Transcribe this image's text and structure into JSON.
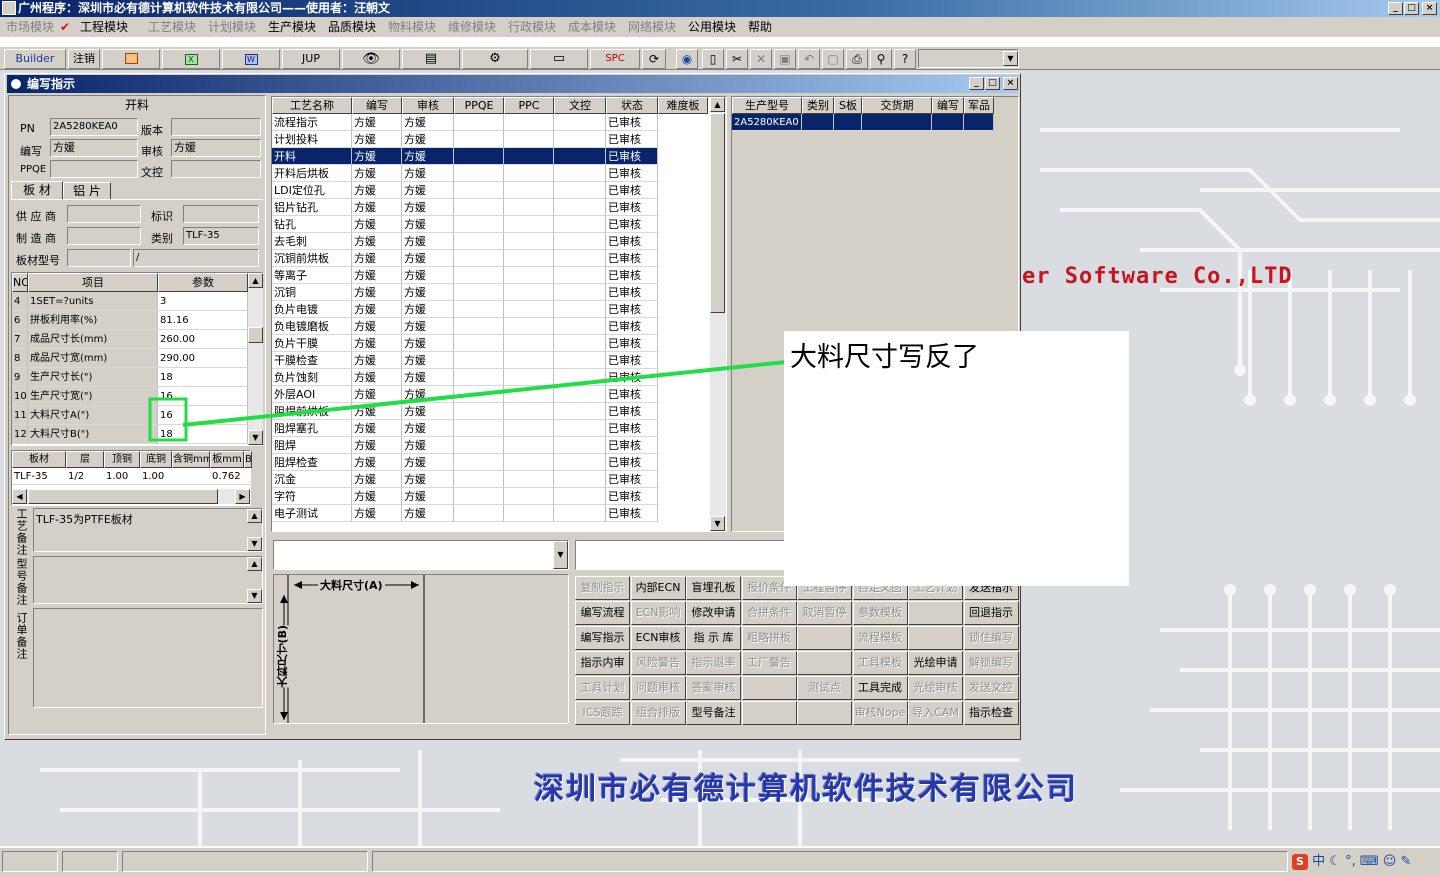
{
  "app": {
    "title": "广州程序：深圳市必有德计算机软件技术有限公司——使用者：汪朝文",
    "min": "_",
    "max": "□",
    "close": "×"
  },
  "menu": [
    {
      "label": "市场模块",
      "enabled": false
    },
    {
      "label": "工程模块",
      "enabled": true,
      "checked": true
    },
    {
      "label": "工艺模块",
      "enabled": false
    },
    {
      "label": "计划模块",
      "enabled": false
    },
    {
      "label": "生产模块",
      "enabled": true
    },
    {
      "label": "品质模块",
      "enabled": true
    },
    {
      "label": "物料模块",
      "enabled": false
    },
    {
      "label": "维修模块",
      "enabled": false
    },
    {
      "label": "行政模块",
      "enabled": false
    },
    {
      "label": "成本模块",
      "enabled": false
    },
    {
      "label": "网络模块",
      "enabled": false
    },
    {
      "label": "公用模块",
      "enabled": true
    },
    {
      "label": "帮助",
      "enabled": true
    }
  ],
  "toolbar": {
    "builder": "Builder",
    "logout": "注销",
    "jup": "JUP",
    "spc": "SPC"
  },
  "background": {
    "watermark": "er Software Co.,LTD",
    "company": "深圳市必有德计算机软件技术有限公司"
  },
  "window": {
    "title": "编写指示",
    "left": {
      "section_title": "开料",
      "pn_label": "PN",
      "pn": "2A5280KEA0",
      "version_label": "版本",
      "version": "",
      "writer_label": "编写",
      "writer": "方媛",
      "reviewer_label": "审核",
      "reviewer": "方媛",
      "ppqe_label": "PPQE",
      "ppqe": "",
      "wenkong_label": "文控",
      "wenkong": "",
      "tabs": [
        "板 材",
        "铝 片"
      ],
      "supplier_label": "供 应 商",
      "supplier": "",
      "mark_label": "标识",
      "mark": "",
      "maker_label": "制 造 商",
      "maker": "",
      "category_label": "类别",
      "category": "TLF-35",
      "model_label": "板材型号",
      "model": "",
      "model2": "/",
      "param_headers": [
        "NO",
        "项目",
        "参数"
      ],
      "params": [
        [
          "4",
          "1SET=?units",
          "3"
        ],
        [
          "6",
          "拼板利用率(%)",
          "81.16"
        ],
        [
          "7",
          "成品尺寸长(mm)",
          "260.00"
        ],
        [
          "8",
          "成品尺寸宽(mm)",
          "290.00"
        ],
        [
          "9",
          "生产尺寸长(\")",
          "18"
        ],
        [
          "10",
          "生产尺寸宽(\")",
          "16"
        ],
        [
          "11",
          "大料尺寸A(\")",
          "16"
        ],
        [
          "12",
          "大料尺寸B(\")",
          "18"
        ]
      ],
      "board_headers": [
        "板材",
        "层",
        "顶铜",
        "底铜",
        "含铜mm",
        "板mm",
        "B"
      ],
      "board_row": [
        "TLF-35",
        "1/2",
        "1.00",
        "1.00",
        "",
        "0.762",
        ""
      ],
      "notes": {
        "process_label": "工艺备注",
        "process": "TLF-35为PTFE板材",
        "model_label": "型号备注",
        "model": "",
        "order_label": "订单备注",
        "order": ""
      }
    },
    "process": {
      "headers": [
        "工艺名称",
        "编写",
        "审核",
        "PPQE",
        "PPC",
        "文控",
        "状态",
        "难度板"
      ],
      "rows": [
        [
          "流程指示",
          "方媛",
          "方媛",
          "",
          "",
          "",
          "已审核",
          ""
        ],
        [
          "计划投料",
          "方媛",
          "方媛",
          "",
          "",
          "",
          "已审核",
          ""
        ],
        [
          "开料",
          "方媛",
          "方媛",
          "",
          "",
          "",
          "已审核",
          ""
        ],
        [
          "开料后烘板",
          "方媛",
          "方媛",
          "",
          "",
          "",
          "已审核",
          ""
        ],
        [
          "LDI定位孔",
          "方媛",
          "方媛",
          "",
          "",
          "",
          "已审核",
          ""
        ],
        [
          "铝片钻孔",
          "方媛",
          "方媛",
          "",
          "",
          "",
          "已审核",
          ""
        ],
        [
          "钻孔",
          "方媛",
          "方媛",
          "",
          "",
          "",
          "已审核",
          ""
        ],
        [
          "去毛刺",
          "方媛",
          "方媛",
          "",
          "",
          "",
          "已审核",
          ""
        ],
        [
          "沉铜前烘板",
          "方媛",
          "方媛",
          "",
          "",
          "",
          "已审核",
          ""
        ],
        [
          "等离子",
          "方媛",
          "方媛",
          "",
          "",
          "",
          "已审核",
          ""
        ],
        [
          "沉铜",
          "方媛",
          "方媛",
          "",
          "",
          "",
          "已审核",
          ""
        ],
        [
          "负片电镀",
          "方媛",
          "方媛",
          "",
          "",
          "",
          "已审核",
          ""
        ],
        [
          "负电镀磨板",
          "方媛",
          "方媛",
          "",
          "",
          "",
          "已审核",
          ""
        ],
        [
          "负片干膜",
          "方媛",
          "方媛",
          "",
          "",
          "",
          "已审核",
          ""
        ],
        [
          "干膜检查",
          "方媛",
          "方媛",
          "",
          "",
          "",
          "已审核",
          ""
        ],
        [
          "负片蚀刻",
          "方媛",
          "方媛",
          "",
          "",
          "",
          "已审核",
          ""
        ],
        [
          "外层AOI",
          "方媛",
          "方媛",
          "",
          "",
          "",
          "已审核",
          ""
        ],
        [
          "阻焊前烘板",
          "方媛",
          "方媛",
          "",
          "",
          "",
          "已审核",
          ""
        ],
        [
          "阻焊塞孔",
          "方媛",
          "方媛",
          "",
          "",
          "",
          "已审核",
          ""
        ],
        [
          "阻焊",
          "方媛",
          "方媛",
          "",
          "",
          "",
          "已审核",
          ""
        ],
        [
          "阻焊检查",
          "方媛",
          "方媛",
          "",
          "",
          "",
          "已审核",
          ""
        ],
        [
          "沉金",
          "方媛",
          "方媛",
          "",
          "",
          "",
          "已审核",
          ""
        ],
        [
          "字符",
          "方媛",
          "方媛",
          "",
          "",
          "",
          "已审核",
          ""
        ],
        [
          "电子测试",
          "方媛",
          "方媛",
          "",
          "",
          "",
          "已审核",
          ""
        ]
      ],
      "selected": 2
    },
    "product": {
      "headers": [
        "生产型号",
        "类别",
        "S板",
        "交货期",
        "编写",
        "军品"
      ],
      "rows": [
        [
          "2A5280KEA0",
          "",
          "",
          "",
          "",
          ""
        ]
      ]
    },
    "diagram": {
      "a_label": "大料尺寸(A)",
      "b_label": "大料尺寸(B)"
    },
    "actions": [
      [
        "复制指示",
        "内部ECN",
        "盲埋孔板",
        "报价条件",
        "工程暂停",
        "自定义图",
        "工艺计划",
        "发送指示"
      ],
      [
        "编写流程",
        "ECN影响",
        "修改申请",
        "合拼条件",
        "取消暂停",
        "参数模板",
        "",
        "回退指示"
      ],
      [
        "编写指示",
        "ECN审核",
        "指 示 库",
        "粗略拼板",
        "",
        "流程模板",
        "",
        "锁住编写"
      ],
      [
        "指示内审",
        "风险警告",
        "指示退率",
        "工厂警告",
        "",
        "工具模板",
        "光绘申请",
        "解锁编写"
      ],
      [
        "工具计划",
        "问题审核",
        "答案审核",
        "",
        "测试点",
        "工具完成",
        "光绘审核",
        "发送文控"
      ],
      [
        "ICS跟踪",
        "组合排版",
        "型号备注",
        "",
        "",
        "审核Nope",
        "导入CAM",
        "指示检查"
      ]
    ],
    "actions_enabled": [
      [
        0,
        1,
        1,
        0,
        0,
        0,
        0,
        1
      ],
      [
        1,
        0,
        1,
        0,
        0,
        0,
        1,
        1
      ],
      [
        1,
        1,
        1,
        0,
        1,
        0,
        1,
        0
      ],
      [
        1,
        0,
        0,
        0,
        1,
        0,
        1,
        0
      ],
      [
        0,
        0,
        0,
        1,
        0,
        1,
        0,
        0
      ],
      [
        0,
        0,
        1,
        1,
        1,
        0,
        0,
        1
      ]
    ]
  },
  "annotation": {
    "text": "大料尺寸写反了",
    "color": "#22dd44"
  },
  "tray": {
    "ime": "中"
  }
}
